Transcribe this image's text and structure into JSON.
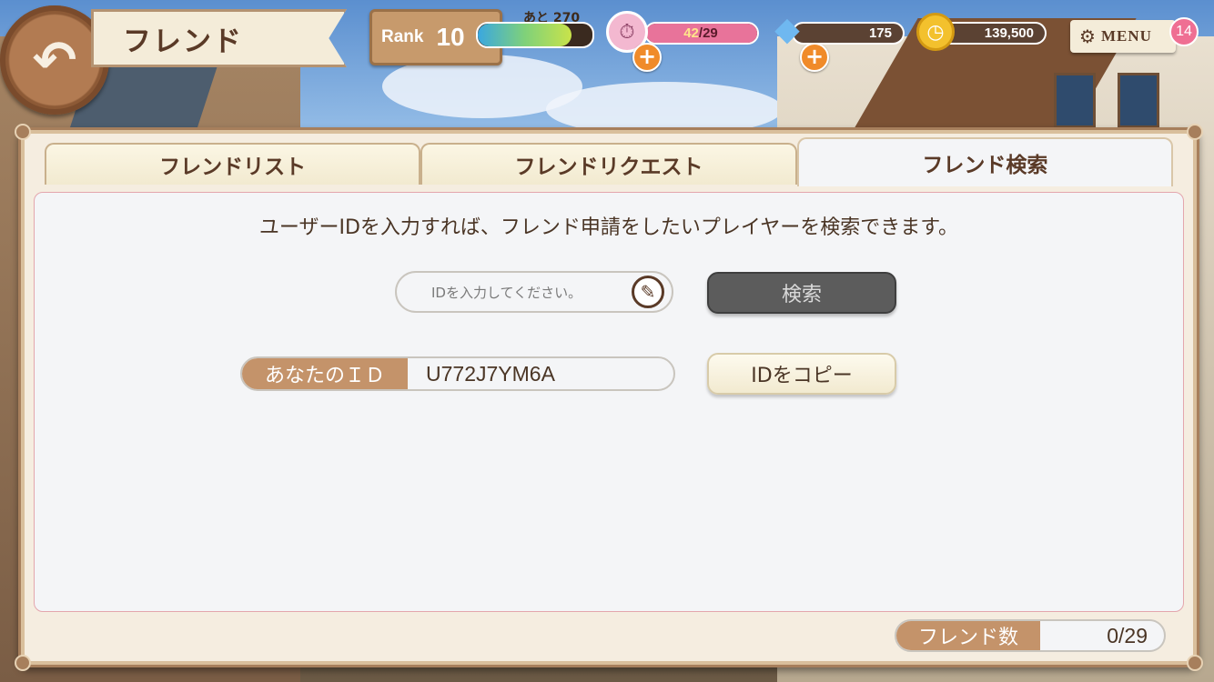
{
  "header": {
    "title": "フレンド",
    "back_icon": "back-arrow-icon",
    "rank_label": "Rank",
    "rank_value": "10",
    "exp_label": "あと 270",
    "exp_progress": 0.82,
    "stamina_current": "42",
    "stamina_max": "/29",
    "gems": "175",
    "gold": "139,500",
    "menu_label": "MENU",
    "menu_badge": "14"
  },
  "tabs": [
    {
      "label": "フレンドリスト",
      "active": false
    },
    {
      "label": "フレンドリクエスト",
      "active": false
    },
    {
      "label": "フレンド検索",
      "active": true
    }
  ],
  "search": {
    "description": "ユーザーIDを入力すれば、フレンド申請をしたいプレイヤーを検索できます。",
    "placeholder": "IDを入力してください。",
    "search_button": "検索",
    "my_id_label": "あなたのＩＤ",
    "my_id_value": "U772J7YM6A",
    "copy_button": "IDをコピー"
  },
  "footer": {
    "friend_count_label": "フレンド数",
    "friend_count_value": "0/29"
  },
  "colors": {
    "accent_brown": "#c4936a",
    "text_brown": "#5a3a27",
    "stamina_pink": "#e8739a",
    "plus_orange": "#f08b2a"
  }
}
